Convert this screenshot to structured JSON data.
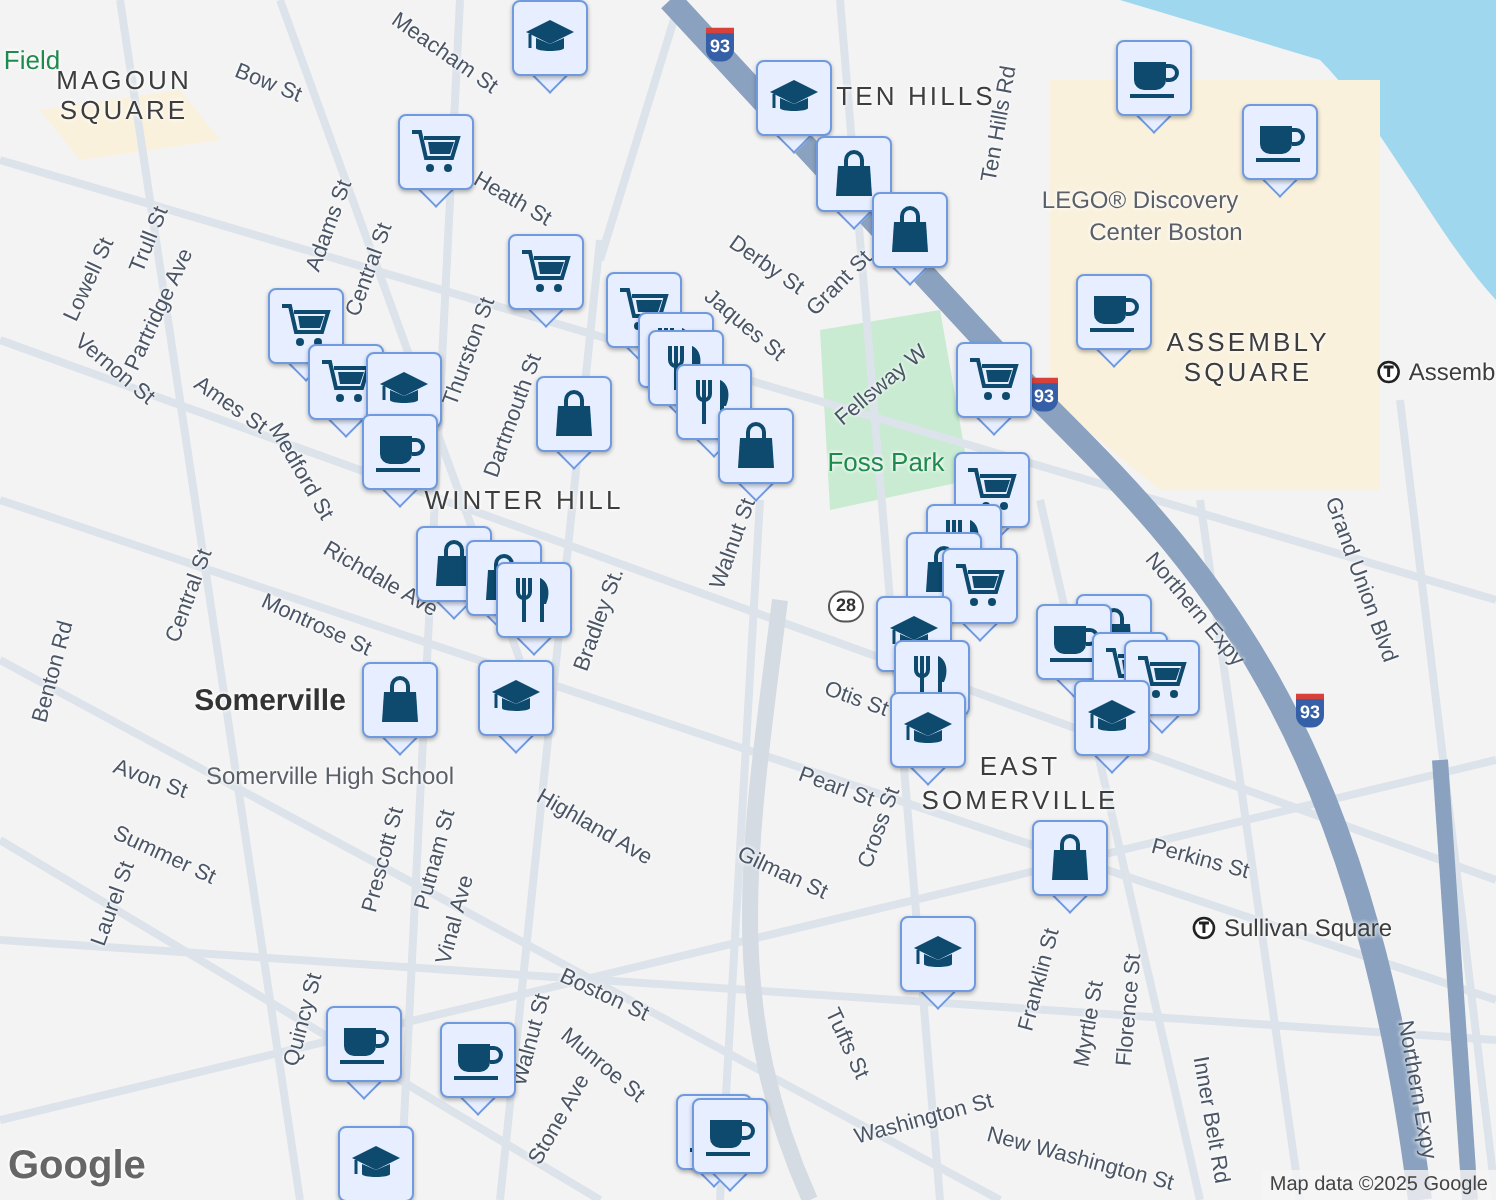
{
  "map": {
    "labels": [
      {
        "text": "Field",
        "kind": "park"
      },
      {
        "text": "MAGOUN",
        "kind": "area"
      },
      {
        "text": "SQUARE",
        "kind": "area"
      },
      {
        "text": "TEN HILLS",
        "kind": "area"
      },
      {
        "text": "LEGO® Discovery",
        "kind": "poi"
      },
      {
        "text": "Center Boston",
        "kind": "poi"
      },
      {
        "text": "ASSEMBLY",
        "kind": "area"
      },
      {
        "text": "SQUARE",
        "kind": "area"
      },
      {
        "text": "Assemb",
        "kind": "station"
      },
      {
        "text": "Foss Park",
        "kind": "park"
      },
      {
        "text": "WINTER HILL",
        "kind": "area"
      },
      {
        "text": "Somerville",
        "kind": "city"
      },
      {
        "text": "Somerville High School",
        "kind": "poi"
      },
      {
        "text": "EAST",
        "kind": "area"
      },
      {
        "text": "SOMERVILLE",
        "kind": "area"
      },
      {
        "text": "Sullivan Square",
        "kind": "station"
      },
      {
        "text": "Bow St",
        "kind": "street"
      },
      {
        "text": "Meacham St",
        "kind": "street"
      },
      {
        "text": "Heath St",
        "kind": "street"
      },
      {
        "text": "Derby St",
        "kind": "street"
      },
      {
        "text": "Jaques St",
        "kind": "street"
      },
      {
        "text": "Grant St",
        "kind": "street"
      },
      {
        "text": "Ten Hills Rd",
        "kind": "street"
      },
      {
        "text": "Lowell St",
        "kind": "street"
      },
      {
        "text": "Trull St",
        "kind": "street"
      },
      {
        "text": "Partridge Ave",
        "kind": "street"
      },
      {
        "text": "Adams St",
        "kind": "street"
      },
      {
        "text": "Central St",
        "kind": "street"
      },
      {
        "text": "Vernon St",
        "kind": "street"
      },
      {
        "text": "Ames St",
        "kind": "street"
      },
      {
        "text": "Medford St",
        "kind": "street"
      },
      {
        "text": "Thurston St",
        "kind": "street"
      },
      {
        "text": "Dartmouth St",
        "kind": "street"
      },
      {
        "text": "Walnut St",
        "kind": "street"
      },
      {
        "text": "Richdale Ave",
        "kind": "street"
      },
      {
        "text": "Montrose St",
        "kind": "street"
      },
      {
        "text": "Bradley St.",
        "kind": "street"
      },
      {
        "text": "Central St",
        "kind": "street"
      },
      {
        "text": "Benton Rd",
        "kind": "street"
      },
      {
        "text": "Avon St",
        "kind": "street"
      },
      {
        "text": "Summer St",
        "kind": "street"
      },
      {
        "text": "Laurel St",
        "kind": "street"
      },
      {
        "text": "Prescott St",
        "kind": "street"
      },
      {
        "text": "Putnam St",
        "kind": "street"
      },
      {
        "text": "Vinal Ave",
        "kind": "street"
      },
      {
        "text": "Highland Ave",
        "kind": "street"
      },
      {
        "text": "Walnut St",
        "kind": "street"
      },
      {
        "text": "Boston St",
        "kind": "street"
      },
      {
        "text": "Munroe St",
        "kind": "street"
      },
      {
        "text": "Stone Ave",
        "kind": "street"
      },
      {
        "text": "Quincy St",
        "kind": "street"
      },
      {
        "text": "Gilman St",
        "kind": "street"
      },
      {
        "text": "Cross St",
        "kind": "street"
      },
      {
        "text": "Pearl St",
        "kind": "street"
      },
      {
        "text": "Otis St",
        "kind": "street"
      },
      {
        "text": "Fellsway W",
        "kind": "street"
      },
      {
        "text": "Northern Expy",
        "kind": "street"
      },
      {
        "text": "Grand Union Blvd",
        "kind": "street"
      },
      {
        "text": "Perkins St",
        "kind": "street"
      },
      {
        "text": "Franklin St",
        "kind": "street"
      },
      {
        "text": "Myrtle St",
        "kind": "street"
      },
      {
        "text": "Florence St",
        "kind": "street"
      },
      {
        "text": "Tufts St",
        "kind": "street"
      },
      {
        "text": "Washington St",
        "kind": "street"
      },
      {
        "text": "New Washington St",
        "kind": "street"
      },
      {
        "text": "Inner Belt Rd",
        "kind": "street"
      },
      {
        "text": "Northern Expy",
        "kind": "street"
      }
    ],
    "shields": [
      {
        "text": "93",
        "kind": "interstate"
      },
      {
        "text": "93",
        "kind": "interstate"
      },
      {
        "text": "93",
        "kind": "interstate"
      },
      {
        "text": "28",
        "kind": "state"
      }
    ],
    "pins": [
      {
        "kind": "school"
      },
      {
        "kind": "school"
      },
      {
        "kind": "cart"
      },
      {
        "kind": "bag"
      },
      {
        "kind": "bag"
      },
      {
        "kind": "cup"
      },
      {
        "kind": "cup"
      },
      {
        "kind": "cup"
      },
      {
        "kind": "cart"
      },
      {
        "kind": "cart"
      },
      {
        "kind": "food"
      },
      {
        "kind": "food"
      },
      {
        "kind": "food"
      },
      {
        "kind": "bag"
      },
      {
        "kind": "cart"
      },
      {
        "kind": "cart"
      },
      {
        "kind": "school"
      },
      {
        "kind": "cup"
      },
      {
        "kind": "bag"
      },
      {
        "kind": "cart"
      },
      {
        "kind": "cart"
      },
      {
        "kind": "food"
      },
      {
        "kind": "bag"
      },
      {
        "kind": "cart"
      },
      {
        "kind": "school"
      },
      {
        "kind": "food"
      },
      {
        "kind": "school"
      },
      {
        "kind": "bag"
      },
      {
        "kind": "cup"
      },
      {
        "kind": "cart"
      },
      {
        "kind": "cart"
      },
      {
        "kind": "school"
      },
      {
        "kind": "bag"
      },
      {
        "kind": "bag"
      },
      {
        "kind": "bag"
      },
      {
        "kind": "food"
      },
      {
        "kind": "bag"
      },
      {
        "kind": "school"
      },
      {
        "kind": "school"
      },
      {
        "kind": "cup"
      },
      {
        "kind": "cup"
      },
      {
        "kind": "cup"
      },
      {
        "kind": "cup"
      },
      {
        "kind": "school"
      }
    ]
  },
  "logo": "Google",
  "attribution": "Map data ©2025 Google"
}
